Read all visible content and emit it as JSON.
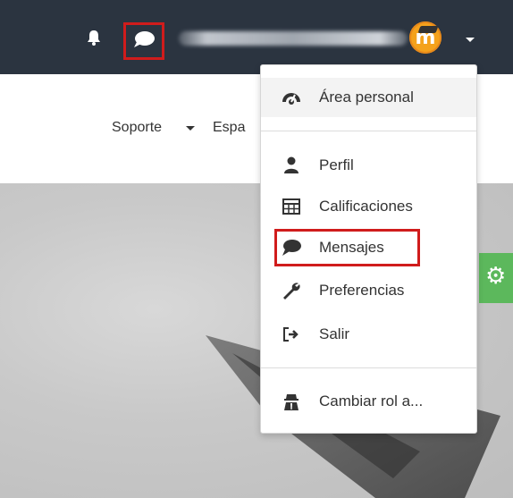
{
  "navbar": {
    "avatar_letter": "m"
  },
  "subnav": {
    "soporte_label": "Soporte",
    "espacio_label": "Espa"
  },
  "user_menu": {
    "items": [
      {
        "label": "Área personal",
        "icon": "dashboard-icon"
      },
      {
        "label": "Perfil",
        "icon": "user-icon"
      },
      {
        "label": "Calificaciones",
        "icon": "table-icon"
      },
      {
        "label": "Mensajes",
        "icon": "comment-icon"
      },
      {
        "label": "Preferencias",
        "icon": "wrench-icon"
      },
      {
        "label": "Salir",
        "icon": "sign-out-icon"
      },
      {
        "label": "Cambiar rol a...",
        "icon": "user-secret-icon"
      }
    ]
  },
  "colors": {
    "navbar_bg": "#2b3440",
    "highlight_red": "#d01c1c",
    "avatar_orange": "#f4a21c",
    "settings_green": "#5cb85c"
  }
}
